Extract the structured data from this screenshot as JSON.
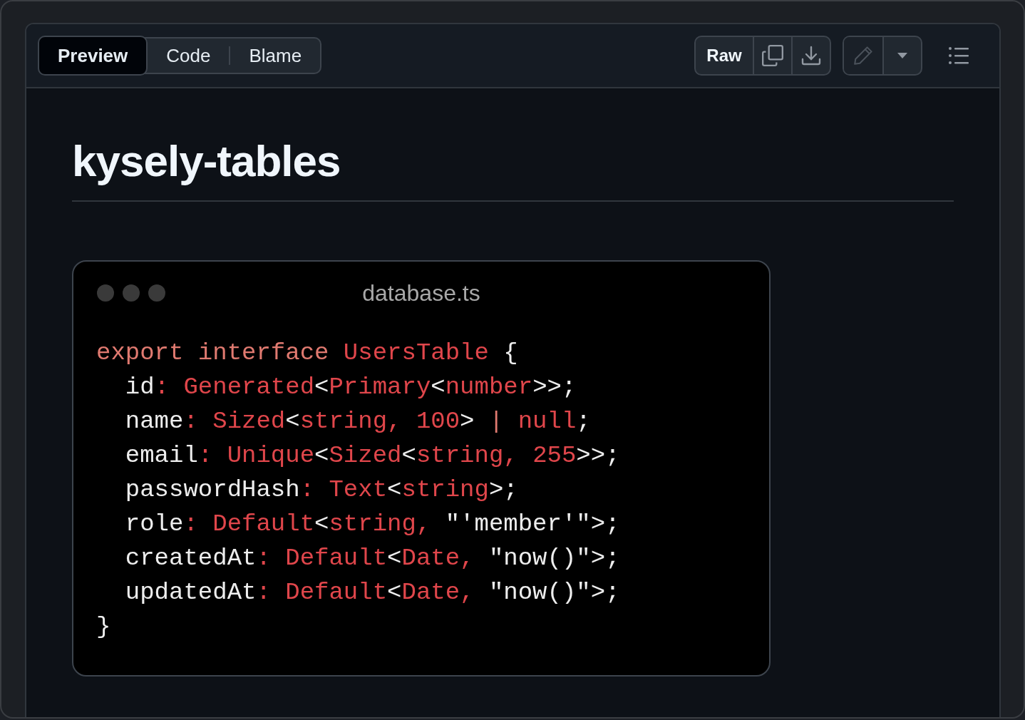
{
  "tabs": [
    {
      "label": "Preview",
      "selected": true
    },
    {
      "label": "Code",
      "selected": false
    },
    {
      "label": "Blame",
      "selected": false
    }
  ],
  "toolbar": {
    "raw_button": "Raw",
    "edit_disabled": true
  },
  "heading": "kysely-tables",
  "code_window": {
    "filename": "database.ts",
    "lines": [
      [
        {
          "text": "export interface ",
          "kind": "keyword"
        },
        {
          "text": "UsersTable",
          "kind": "type"
        },
        {
          "text": " {",
          "kind": "plain"
        }
      ],
      [
        {
          "text": "  id",
          "kind": "plain"
        },
        {
          "text": ": Generated",
          "kind": "type"
        },
        {
          "text": "<",
          "kind": "plain"
        },
        {
          "text": "Primary",
          "kind": "type"
        },
        {
          "text": "<",
          "kind": "plain"
        },
        {
          "text": "number",
          "kind": "type"
        },
        {
          "text": ">>;",
          "kind": "plain"
        }
      ],
      [
        {
          "text": "  name",
          "kind": "plain"
        },
        {
          "text": ": Sized",
          "kind": "type"
        },
        {
          "text": "<",
          "kind": "plain"
        },
        {
          "text": "string, 100",
          "kind": "type"
        },
        {
          "text": "> ",
          "kind": "plain"
        },
        {
          "text": "| ",
          "kind": "keyword"
        },
        {
          "text": "null",
          "kind": "type"
        },
        {
          "text": ";",
          "kind": "plain"
        }
      ],
      [
        {
          "text": "  email",
          "kind": "plain"
        },
        {
          "text": ": Unique",
          "kind": "type"
        },
        {
          "text": "<",
          "kind": "plain"
        },
        {
          "text": "Sized",
          "kind": "type"
        },
        {
          "text": "<",
          "kind": "plain"
        },
        {
          "text": "string, 255",
          "kind": "type"
        },
        {
          "text": ">>;",
          "kind": "plain"
        }
      ],
      [
        {
          "text": "  passwordHash",
          "kind": "plain"
        },
        {
          "text": ": Text",
          "kind": "type"
        },
        {
          "text": "<",
          "kind": "plain"
        },
        {
          "text": "string",
          "kind": "type"
        },
        {
          "text": ">;",
          "kind": "plain"
        }
      ],
      [
        {
          "text": "  role",
          "kind": "plain"
        },
        {
          "text": ": Default",
          "kind": "type"
        },
        {
          "text": "<",
          "kind": "plain"
        },
        {
          "text": "string, ",
          "kind": "type"
        },
        {
          "text": "\"'member'\">;",
          "kind": "plain"
        }
      ],
      [
        {
          "text": "  createdAt",
          "kind": "plain"
        },
        {
          "text": ": Default",
          "kind": "type"
        },
        {
          "text": "<",
          "kind": "plain"
        },
        {
          "text": "Date, ",
          "kind": "type"
        },
        {
          "text": "\"now()\">;",
          "kind": "plain"
        }
      ],
      [
        {
          "text": "  updatedAt",
          "kind": "plain"
        },
        {
          "text": ": Default",
          "kind": "type"
        },
        {
          "text": "<",
          "kind": "plain"
        },
        {
          "text": "Date, ",
          "kind": "type"
        },
        {
          "text": "\"now()\">;",
          "kind": "plain"
        }
      ],
      [
        {
          "text": "}",
          "kind": "plain"
        }
      ]
    ]
  }
}
